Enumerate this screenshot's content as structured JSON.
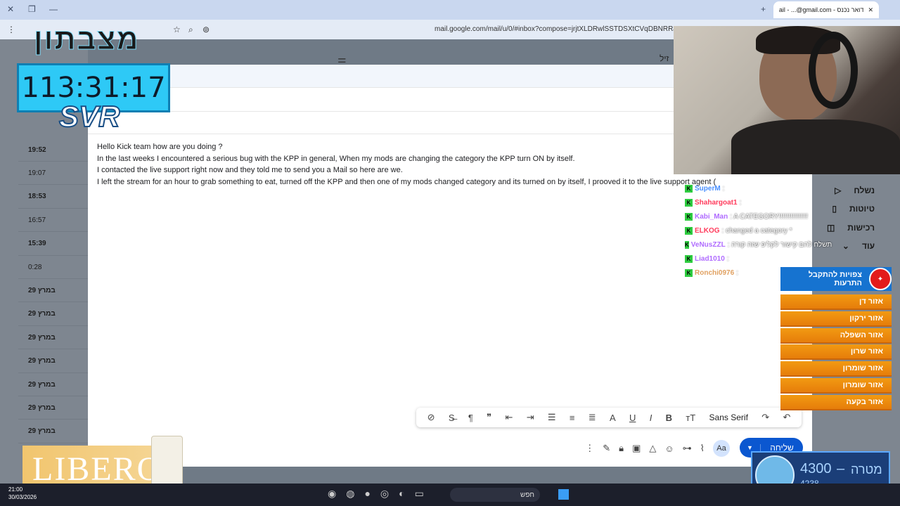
{
  "browser": {
    "tab_title": "דואר נכנס - Gmail - ...@gmail.com",
    "url": "mail.google.com/mail/u/0/#inbox?compose=jrjtXLDRwlSSTDSXtCVqDBNRRJtssDkl",
    "new_tab": "+",
    "close_tab": "✕"
  },
  "gmail_list": {
    "rows": [
      {
        "time": "19:52",
        "style": "bold"
      },
      {
        "time": "19:07",
        "style": "light"
      },
      {
        "time": "18:53",
        "style": "bold"
      },
      {
        "time": "16:57",
        "style": "light"
      },
      {
        "time": "15:39",
        "style": "bold"
      },
      {
        "time": "0:28",
        "style": "light"
      },
      {
        "time": "29 במרץ",
        "style": "bold"
      },
      {
        "time": "29 במרץ",
        "style": "bold"
      },
      {
        "time": "29 במרץ",
        "style": "bold"
      },
      {
        "time": "29 במרץ",
        "style": "bold"
      },
      {
        "time": "29 במרץ",
        "style": "bold"
      },
      {
        "time": "29 במרץ",
        "style": "bold"
      },
      {
        "time": "29 במרץ",
        "style": "bold"
      }
    ]
  },
  "gmail_sidebar": {
    "sent": "נשלח",
    "drafts": "טיוטות",
    "purchases": "רכישות",
    "more": "עוד",
    "partial": "זיל"
  },
  "compose": {
    "body_lines": [
      "Hello Kick team how are you doing ?",
      "In the last weeks I encountered a serious bug with the KPP in general, When my mods are changing the category the KPP turn ON by itself.",
      "I contacted the live support right now and they told me to send you a Mail so here are we.",
      "I left the stream for an hour to grab something to eat, turned off the KPP and then one of my mods changed category and its turned on by itself, I prooved it to the live support agent ("
    ],
    "font_name": "Sans Serif",
    "send_label": "שליחה",
    "aa_label": "Aa"
  },
  "overlay": {
    "logo_text": "מצבתון",
    "timer": "113:31:17",
    "svr": "SVR",
    "perfume_brand": "LIBERO",
    "goal_label": "מטרה",
    "goal_target": "4300",
    "goal_dash": "–",
    "goal_current": "4238"
  },
  "chat": [
    {
      "user": "SuperM",
      "msg": ":",
      "color": "#4a90ff"
    },
    {
      "user": "Shahargoat1",
      "msg": ":",
      "color": "#ff3b5c"
    },
    {
      "user": "Kabi_Man",
      "msg": ": A CATEGORY!!!!!!!!!!!!!!!",
      "color": "#b06cff"
    },
    {
      "user": "ELKOG",
      "msg": ": changed a category *",
      "color": "#ff3b5c"
    },
    {
      "user": "VeNusZZL",
      "msg": ": תשלח להם קישור לקליפ שזה קורה",
      "color": "#b06cff"
    },
    {
      "user": "Liad1010",
      "msg": ":",
      "color": "#b06cff"
    },
    {
      "user": "Ronchi0976",
      "msg": ":",
      "color": "#e0a060"
    }
  ],
  "alerts": {
    "header": "צפויות להתקבל התרעות",
    "zones": [
      "אזור דן",
      "אזור ירקון",
      "אזור השפלה",
      "אזור שרון",
      "אזור שומרון",
      "אזור שומרון",
      "אזור בקעה"
    ]
  },
  "taskbar": {
    "time": "21:00",
    "date": "30/03/2026",
    "search": "חפש"
  }
}
